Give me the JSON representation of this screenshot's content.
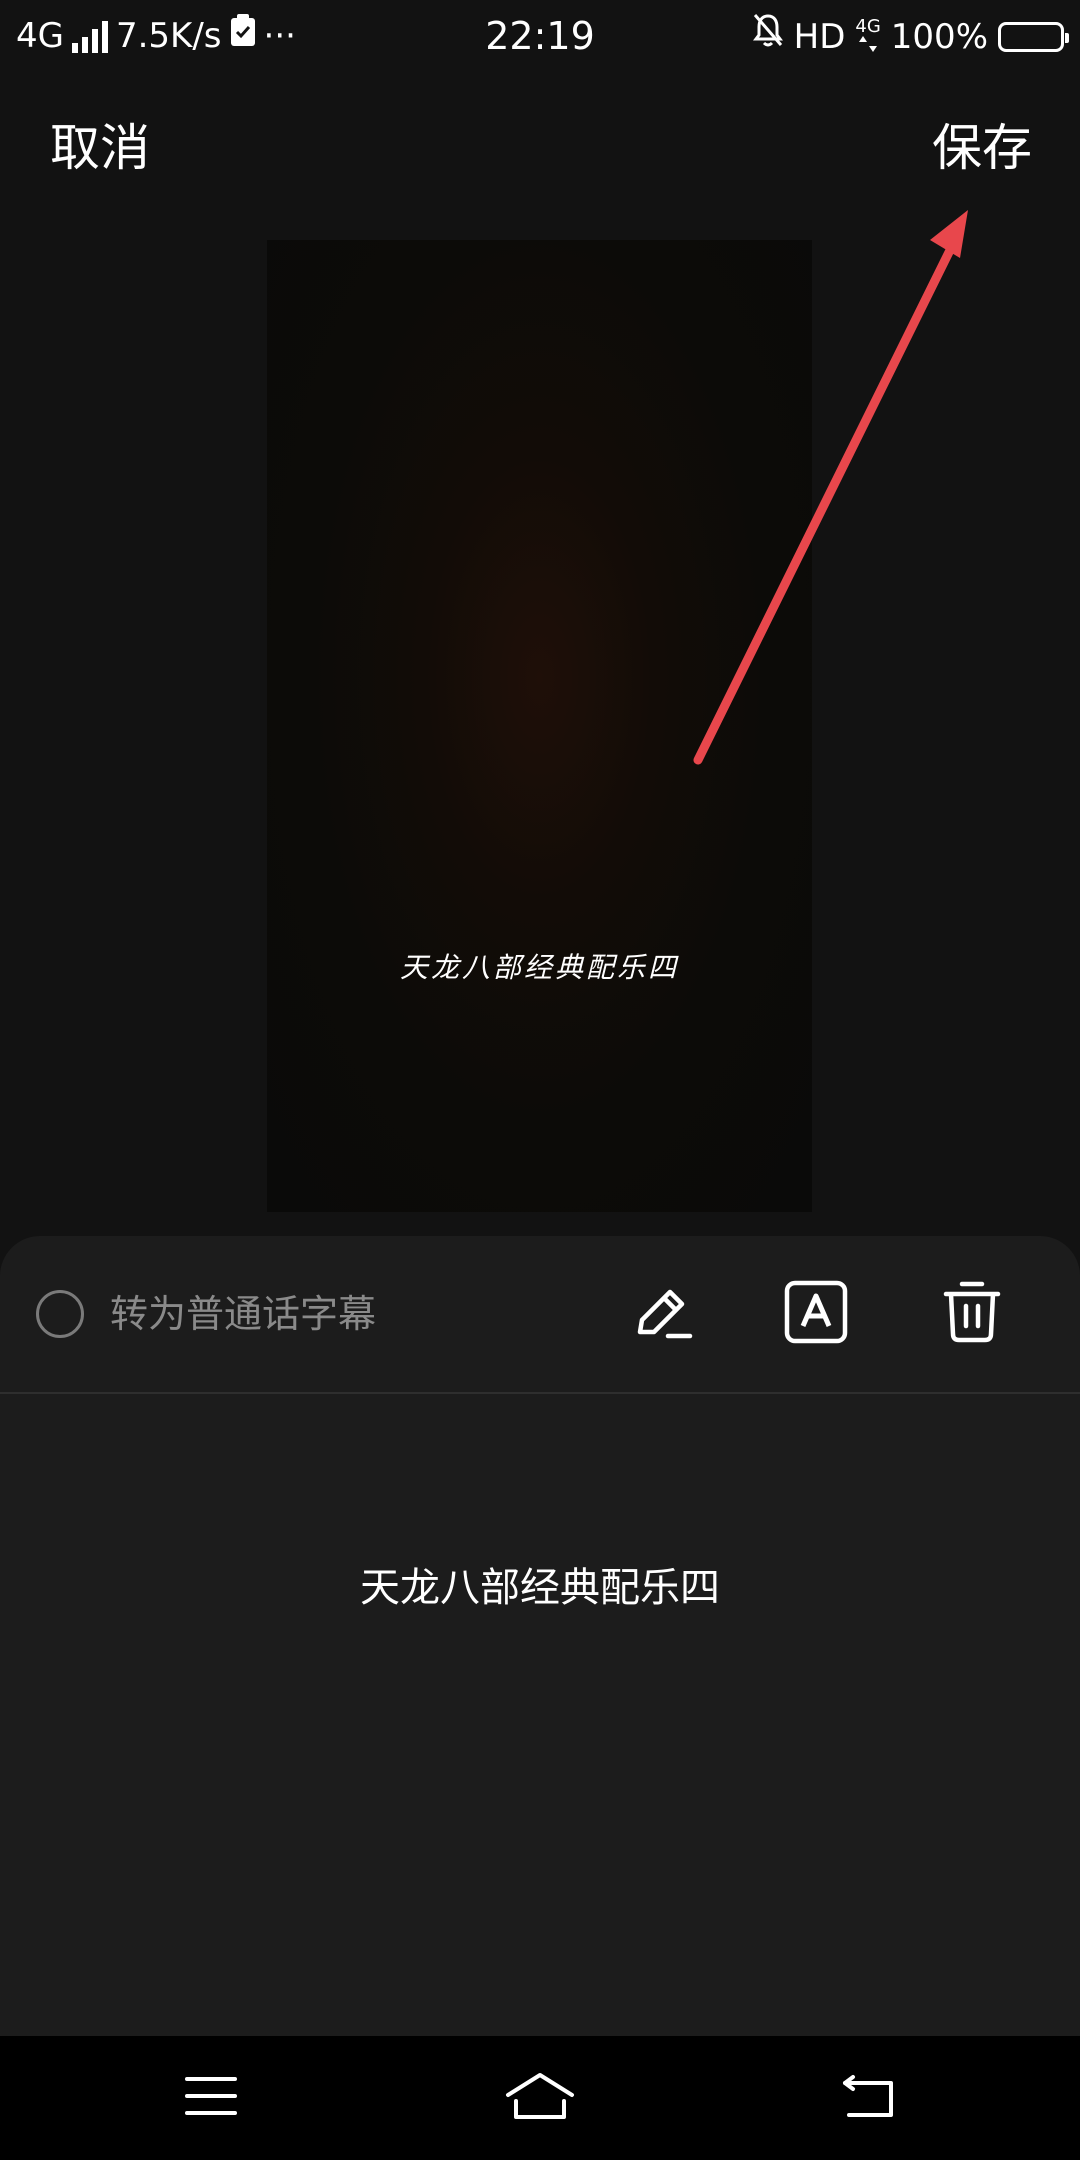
{
  "status_bar": {
    "network": "4G",
    "speed": "7.5K/s",
    "more": "···",
    "time": "22:19",
    "hd": "HD",
    "net_small_top": "4G",
    "battery_percent": "100%",
    "battery_level": 1.0
  },
  "header": {
    "cancel_label": "取消",
    "save_label": "保存"
  },
  "preview": {
    "caption": "天龙八部经典配乐四"
  },
  "toolbar": {
    "convert_label": "转为普通话字幕"
  },
  "subtitle": {
    "text": "天龙八部经典配乐四"
  },
  "colors": {
    "background": "#121212",
    "panel": "#1c1c1c",
    "annotation_arrow": "#e8474c"
  },
  "icons": {
    "edit": "pencil-icon",
    "font": "font-a-icon",
    "delete": "trash-icon",
    "menu": "menu-icon",
    "home": "home-icon",
    "back": "back-icon"
  }
}
